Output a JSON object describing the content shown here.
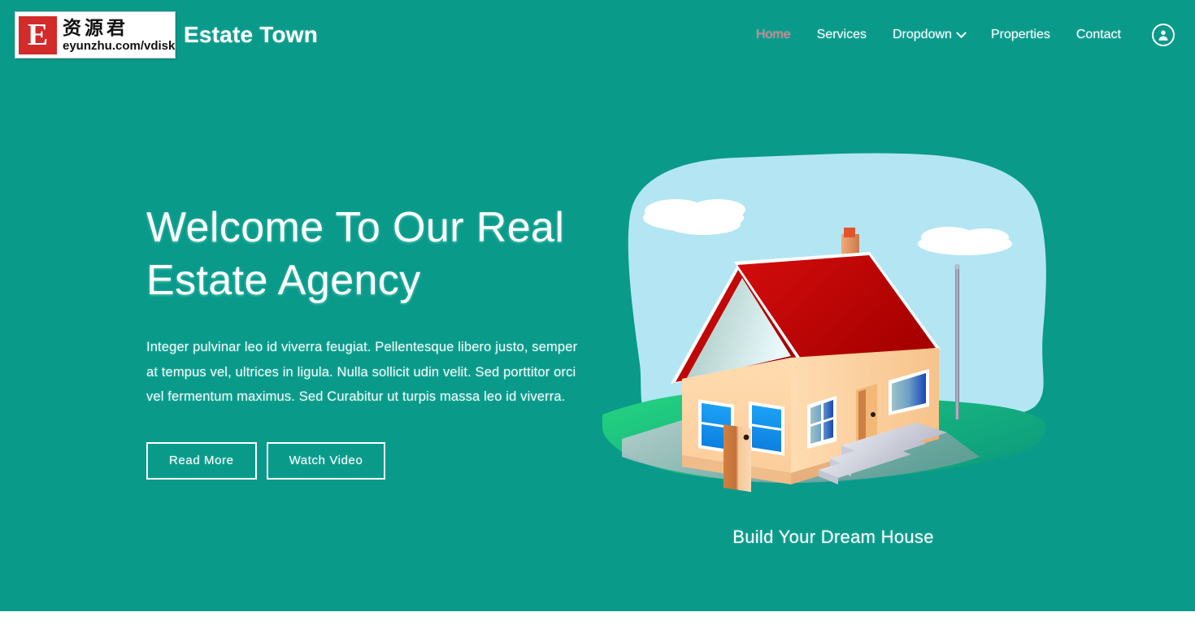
{
  "theme": {
    "teal": "#099a8a",
    "accent_pink": "#ff7a8a",
    "white": "#ffffff",
    "sky": "#b3e6f2",
    "grass": "#19c97f",
    "roof_red": "#c40000",
    "wall_peach": "#fbd3a3"
  },
  "watermark": {
    "mark_letter": "E",
    "cn_text": "资源君",
    "url_text": "eyunzhu.com/vdisk"
  },
  "header": {
    "brand_title": "Estate Town",
    "nav": [
      {
        "label": "Home",
        "active": true,
        "has_chevron": false
      },
      {
        "label": "Services",
        "active": false,
        "has_chevron": false
      },
      {
        "label": "Dropdown",
        "active": false,
        "has_chevron": true
      },
      {
        "label": "Properties",
        "active": false,
        "has_chevron": false
      },
      {
        "label": "Contact",
        "active": false,
        "has_chevron": false
      }
    ],
    "account_icon": "user-circle-icon"
  },
  "hero": {
    "title": "Welcome To Our Real Estate Agency",
    "paragraph": "Integer pulvinar leo id viverra feugiat. Pellentesque libero justo, semper at tempus vel, ultrices in ligula. Nulla sollicit udin velit. Sed porttitor orci vel fermentum maximus. Sed Curabitur ut turpis massa leo id viverra.",
    "primary_button": "Read More",
    "secondary_button": "Watch Video",
    "illustration_name": "house-illustration",
    "illustration_caption": "Build Your Dream House"
  }
}
